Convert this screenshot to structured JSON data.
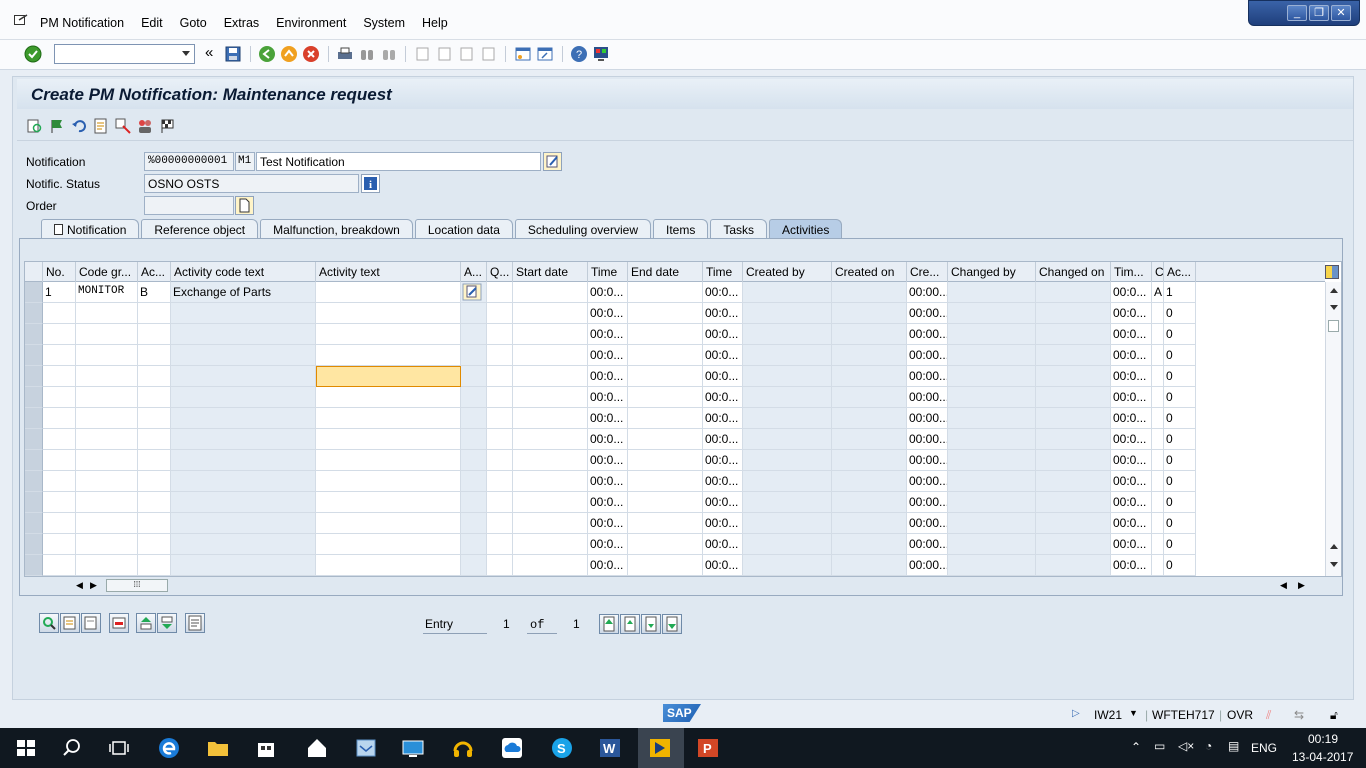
{
  "menubar": {
    "items": [
      "PM Notification",
      "Edit",
      "Goto",
      "Extras",
      "Environment",
      "System",
      "Help"
    ],
    "window_buttons": [
      "_",
      "❐",
      "✕"
    ]
  },
  "page": {
    "title": "Create PM Notification: Maintenance request"
  },
  "header": {
    "notification_label": "Notification",
    "notification_number": "%00000000001",
    "notification_type": "M1",
    "notification_text": "Test Notification",
    "status_label": "Notific. Status",
    "status_value": "OSNO OSTS",
    "order_label": "Order",
    "order_value": ""
  },
  "tabs": [
    {
      "label": "Notification"
    },
    {
      "label": "Reference object"
    },
    {
      "label": "Malfunction, breakdown"
    },
    {
      "label": "Location data"
    },
    {
      "label": "Scheduling overview"
    },
    {
      "label": "Items"
    },
    {
      "label": "Tasks"
    },
    {
      "label": "Activities"
    }
  ],
  "table": {
    "columns": [
      "No.",
      "Code gr...",
      "Ac...",
      "Activity code text",
      "Activity text",
      "A...",
      "Q...",
      "Start date",
      "Time",
      "End date",
      "Time",
      "Created by",
      "Created on",
      "Cre...",
      "Changed by",
      "Changed on",
      "Tim...",
      "C",
      "Ac..."
    ],
    "rows": [
      {
        "no": "1",
        "code_group": "MONITOR",
        "activity": "B",
        "code_text": "Exchange of Parts",
        "activity_text": "",
        "time1": "00:0...",
        "time2": "00:0...",
        "created_time": "00:00...",
        "changed_time": "00:0...",
        "c": "A",
        "ac": "1"
      },
      {
        "no": "",
        "code_group": "",
        "activity": "",
        "code_text": "",
        "activity_text": "",
        "time1": "00:0...",
        "time2": "00:0...",
        "created_time": "00:00...",
        "changed_time": "00:0...",
        "c": "",
        "ac": "0"
      },
      {
        "no": "",
        "code_group": "",
        "activity": "",
        "code_text": "",
        "activity_text": "",
        "time1": "00:0...",
        "time2": "00:0...",
        "created_time": "00:00...",
        "changed_time": "00:0...",
        "c": "",
        "ac": "0"
      },
      {
        "no": "",
        "code_group": "",
        "activity": "",
        "code_text": "",
        "activity_text": "",
        "time1": "00:0...",
        "time2": "00:0...",
        "created_time": "00:00...",
        "changed_time": "00:0...",
        "c": "",
        "ac": "0"
      },
      {
        "no": "",
        "code_group": "",
        "activity": "",
        "code_text": "",
        "activity_text": "",
        "time1": "00:0...",
        "time2": "00:0...",
        "created_time": "00:00...",
        "changed_time": "00:0...",
        "c": "",
        "ac": "0"
      },
      {
        "no": "",
        "code_group": "",
        "activity": "",
        "code_text": "",
        "activity_text": "",
        "time1": "00:0...",
        "time2": "00:0...",
        "created_time": "00:00...",
        "changed_time": "00:0...",
        "c": "",
        "ac": "0"
      },
      {
        "no": "",
        "code_group": "",
        "activity": "",
        "code_text": "",
        "activity_text": "",
        "time1": "00:0...",
        "time2": "00:0...",
        "created_time": "00:00...",
        "changed_time": "00:0...",
        "c": "",
        "ac": "0"
      },
      {
        "no": "",
        "code_group": "",
        "activity": "",
        "code_text": "",
        "activity_text": "",
        "time1": "00:0...",
        "time2": "00:0...",
        "created_time": "00:00...",
        "changed_time": "00:0...",
        "c": "",
        "ac": "0"
      },
      {
        "no": "",
        "code_group": "",
        "activity": "",
        "code_text": "",
        "activity_text": "",
        "time1": "00:0...",
        "time2": "00:0...",
        "created_time": "00:00...",
        "changed_time": "00:0...",
        "c": "",
        "ac": "0"
      },
      {
        "no": "",
        "code_group": "",
        "activity": "",
        "code_text": "",
        "activity_text": "",
        "time1": "00:0...",
        "time2": "00:0...",
        "created_time": "00:00...",
        "changed_time": "00:0...",
        "c": "",
        "ac": "0"
      },
      {
        "no": "",
        "code_group": "",
        "activity": "",
        "code_text": "",
        "activity_text": "",
        "time1": "00:0...",
        "time2": "00:0...",
        "created_time": "00:00...",
        "changed_time": "00:0...",
        "c": "",
        "ac": "0"
      },
      {
        "no": "",
        "code_group": "",
        "activity": "",
        "code_text": "",
        "activity_text": "",
        "time1": "00:0...",
        "time2": "00:0...",
        "created_time": "00:00...",
        "changed_time": "00:0...",
        "c": "",
        "ac": "0"
      },
      {
        "no": "",
        "code_group": "",
        "activity": "",
        "code_text": "",
        "activity_text": "",
        "time1": "00:0...",
        "time2": "00:0...",
        "created_time": "00:00...",
        "changed_time": "00:0...",
        "c": "",
        "ac": "0"
      },
      {
        "no": "",
        "code_group": "",
        "activity": "",
        "code_text": "",
        "activity_text": "",
        "time1": "00:0...",
        "time2": "00:0...",
        "created_time": "00:00...",
        "changed_time": "00:0...",
        "c": "",
        "ac": "0"
      }
    ]
  },
  "pager": {
    "entry_label": "Entry",
    "current": "1",
    "of_label": "of",
    "total": "1"
  },
  "statusbar": {
    "logo": "SAP",
    "transaction": "IW21",
    "server": "WFTEH717",
    "mode": "OVR"
  },
  "taskbar": {
    "language": "ENG",
    "time": "00:19",
    "date": "13-04-2017"
  },
  "colors": {
    "title_text": "#0a1a33",
    "active_tab": "#b7cde6",
    "focus_cell": "#ffe6a2",
    "taskbar": "#101820"
  }
}
